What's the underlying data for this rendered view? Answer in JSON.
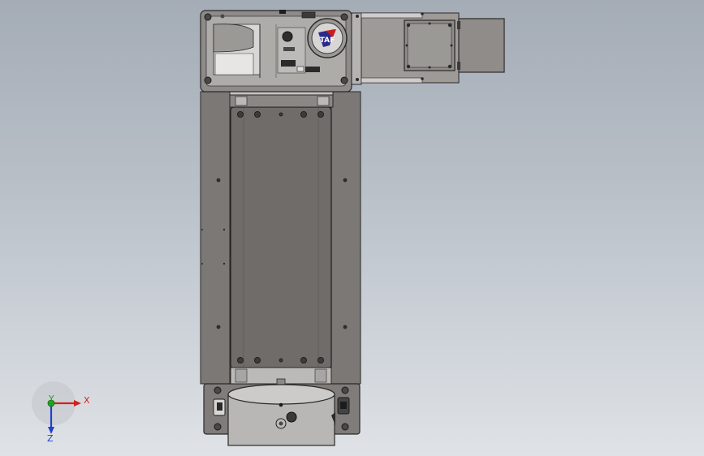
{
  "viewport": {
    "background_top": "#a4acb6",
    "background_bottom": "#dfe2e6"
  },
  "model": {
    "body_color": "#7b7875",
    "dark_color": "#5d5a57",
    "light_color": "#c9c7c5",
    "edge_color": "#2a2a2a",
    "logo_text": "TAF"
  },
  "triad": {
    "x_label": "X",
    "y_label": "Y",
    "z_label": "Z",
    "x_color": "#d42020",
    "y_color": "#1fa51f",
    "z_color": "#2040d0"
  }
}
